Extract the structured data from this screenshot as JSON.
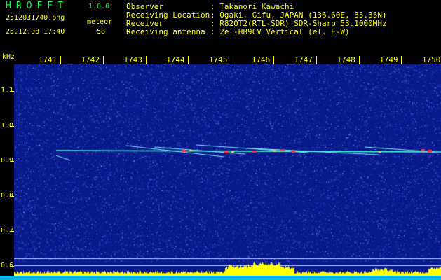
{
  "header": {
    "app_name": "HROFFT",
    "version": "1.0.0",
    "filename": "2512031740.png",
    "datetime": "25.12.03 17:40",
    "meteor_label": "meteor",
    "meteor_count": "58",
    "info": [
      {
        "label": "Observer",
        "value": ": Takanori Kawachi"
      },
      {
        "label": "Receiving Location",
        "value": ": Ogaki, Gifu, JAPAN (136.60E, 35.35N)"
      },
      {
        "label": "Receiver",
        "value": ": R820T2(RTL-SDR) SDR-Sharp 53.1000MHz"
      },
      {
        "label": "Receiving antenna",
        "value": ": 2el-HB9CV Vertical (el. E-W)"
      }
    ]
  },
  "axes": {
    "freq_unit": "kHz",
    "time_ticks": [
      "1741",
      "1742",
      "1743",
      "1744",
      "1745",
      "1746",
      "1747",
      "1748",
      "1749",
      "1750"
    ],
    "freq_ticks": [
      "1.1",
      "1.0",
      "0.9",
      "0.8",
      "0.7",
      "0.6"
    ]
  },
  "colors": {
    "background": "#000000",
    "spectrogram_base": "#0a1a8c",
    "noise": "#4a7cff",
    "carrier": "#40ffd0",
    "meteor_hot": "#ff3030",
    "level_bar": "#ffff00",
    "bottom_bar": "#00b8e8",
    "label_green": "#00ff40",
    "label_yellow": "#ffff00"
  }
}
